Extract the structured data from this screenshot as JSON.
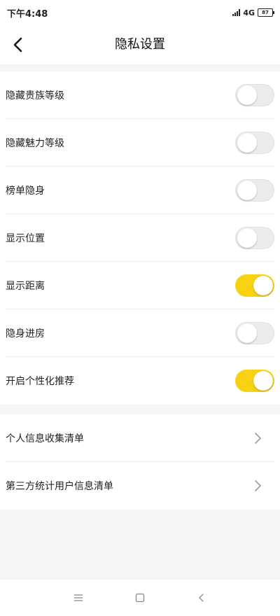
{
  "status_bar": {
    "time": "下午4:48",
    "network": "4G",
    "battery": "87"
  },
  "header": {
    "title": "隐私设置"
  },
  "toggles": [
    {
      "label": "隐藏贵族等级",
      "on": false
    },
    {
      "label": "隐藏魅力等级",
      "on": false
    },
    {
      "label": "榜单隐身",
      "on": false
    },
    {
      "label": "显示位置",
      "on": false
    },
    {
      "label": "显示距离",
      "on": true
    },
    {
      "label": "隐身进房",
      "on": false
    },
    {
      "label": "开启个性化推荐",
      "on": true
    }
  ],
  "links": [
    {
      "label": "个人信息收集清单"
    },
    {
      "label": "第三方统计用户信息清单"
    }
  ],
  "colors": {
    "accent": "#f7d112",
    "toggle_off": "#ececec",
    "background": "#f5f5f5"
  },
  "icons": {
    "back": "back-arrow-icon",
    "chevron": "chevron-right-icon",
    "menu": "menu-icon",
    "home": "home-icon",
    "system_back": "system-back-icon"
  }
}
